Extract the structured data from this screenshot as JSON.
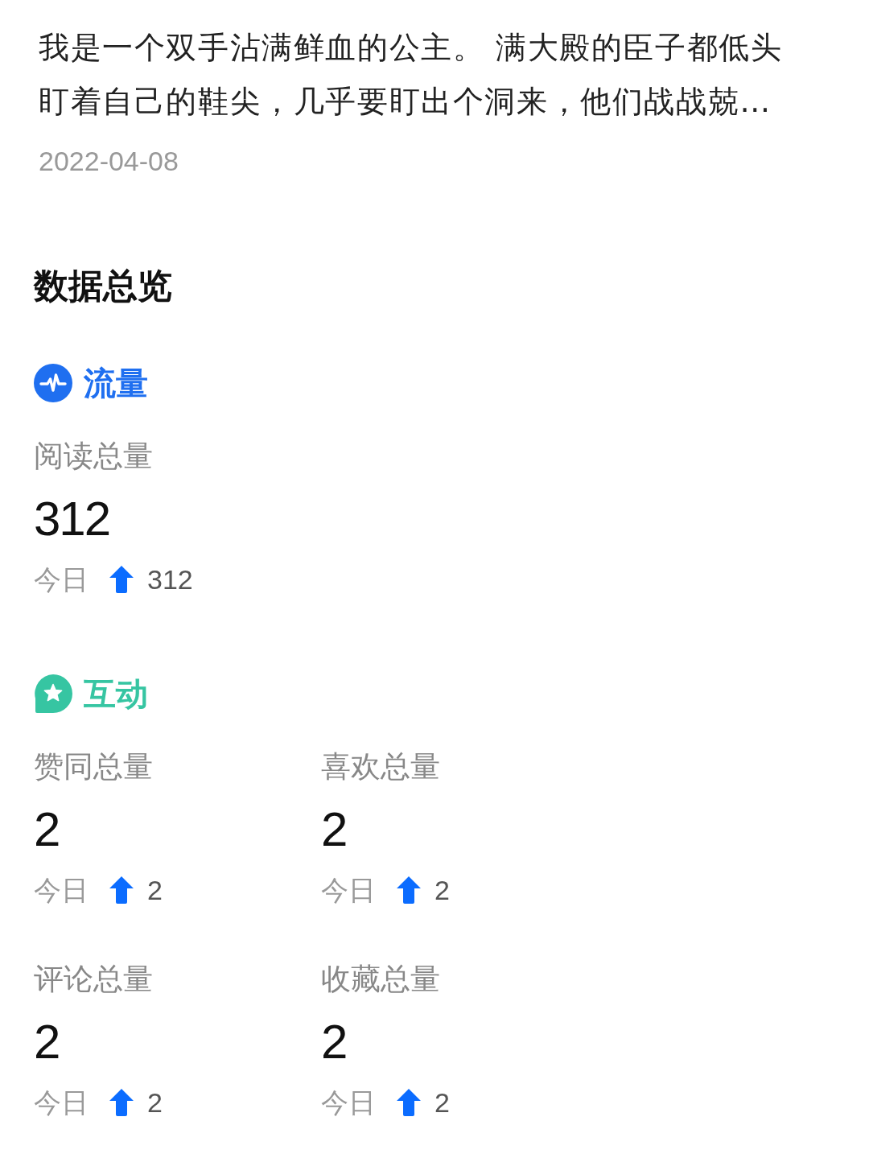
{
  "article": {
    "excerpt": "我是一个双手沾满鲜血的公主。 满大殿的臣子都低头盯着自己的鞋尖，几乎要盯出个洞来，他们战战兢…",
    "date": "2022-04-08"
  },
  "overview": {
    "title": "数据总览",
    "sections": [
      {
        "kind": "traffic",
        "title": "流量",
        "color": "#1f6ff0",
        "metrics": [
          {
            "label": "阅读总量",
            "value": "312",
            "today_label": "今日",
            "today_value": "312"
          }
        ]
      },
      {
        "kind": "interaction",
        "title": "互动",
        "color": "#36c5a2",
        "metrics": [
          {
            "label": "赞同总量",
            "value": "2",
            "today_label": "今日",
            "today_value": "2"
          },
          {
            "label": "喜欢总量",
            "value": "2",
            "today_label": "今日",
            "today_value": "2"
          },
          {
            "label": "评论总量",
            "value": "2",
            "today_label": "今日",
            "today_value": "2"
          },
          {
            "label": "收藏总量",
            "value": "2",
            "today_label": "今日",
            "today_value": "2"
          }
        ]
      }
    ]
  }
}
